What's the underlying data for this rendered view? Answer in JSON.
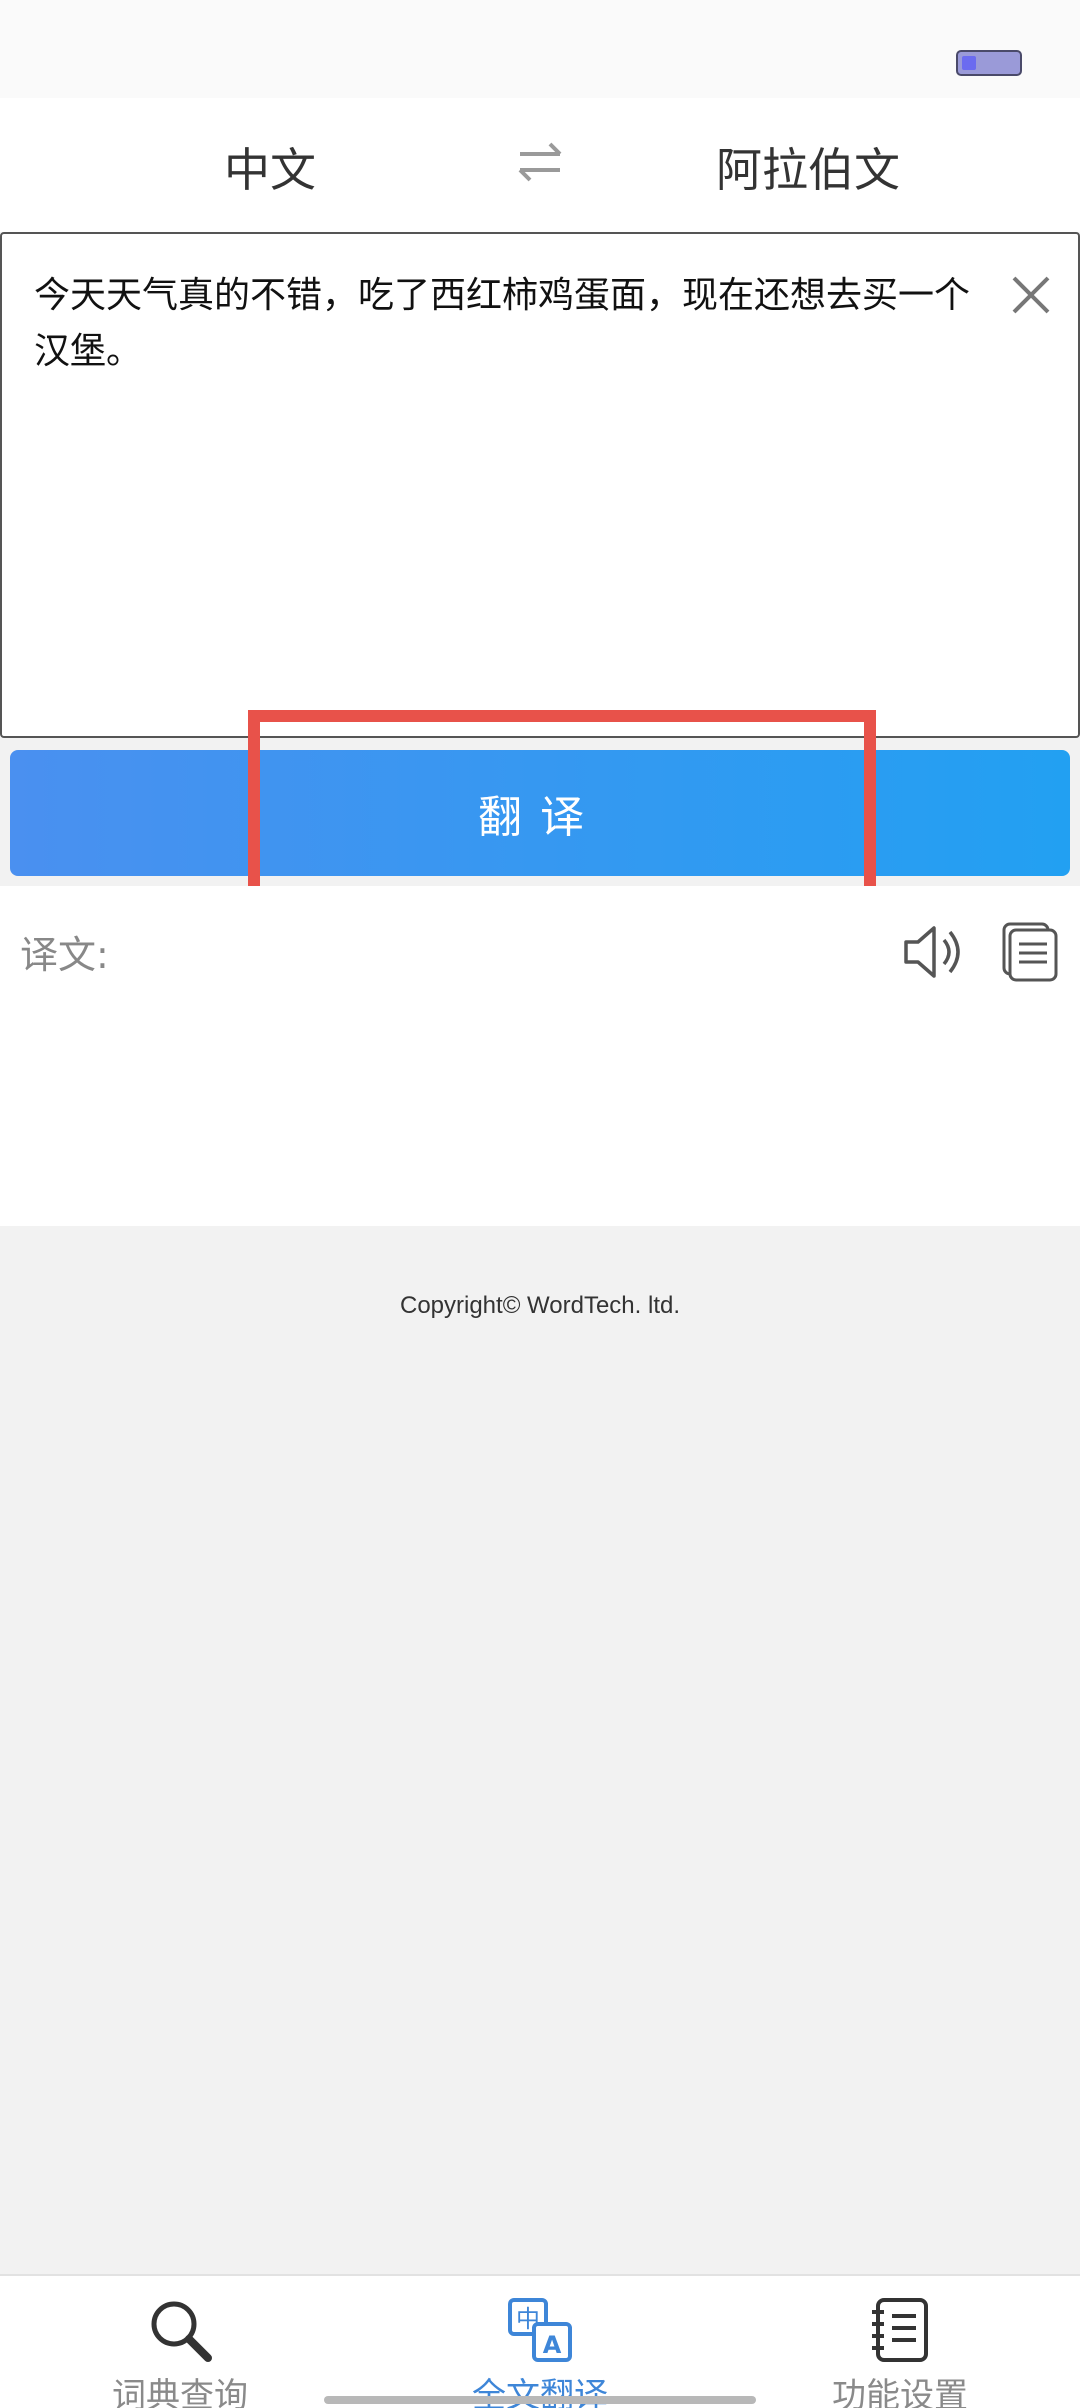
{
  "status_bar": {
    "battery_icon": "battery-icon"
  },
  "language_bar": {
    "source": "中文",
    "target": "阿拉伯文",
    "swap_icon": "swap-arrows-icon"
  },
  "input": {
    "text": "今天天气真的不错，吃了西红柿鸡蛋面，现在还想去买一个汉堡。",
    "clear_icon": "close-icon"
  },
  "translate_button": {
    "label": "翻译"
  },
  "result": {
    "label": "译文:",
    "speaker_icon": "speaker-icon",
    "copy_icon": "copy-icon"
  },
  "footer": {
    "copyright": "Copyright© WordTech. ltd."
  },
  "tabs": [
    {
      "label": "词典查询",
      "icon": "search-icon",
      "active": false
    },
    {
      "label": "全文翻译",
      "icon": "translate-icon",
      "active": true
    },
    {
      "label": "功能设置",
      "icon": "notebook-icon",
      "active": false
    }
  ],
  "colors": {
    "accent": "#3e86d8",
    "button_gradient_start": "#4a90f0",
    "button_gradient_end": "#22a0f2",
    "highlight": "#e8524a"
  }
}
